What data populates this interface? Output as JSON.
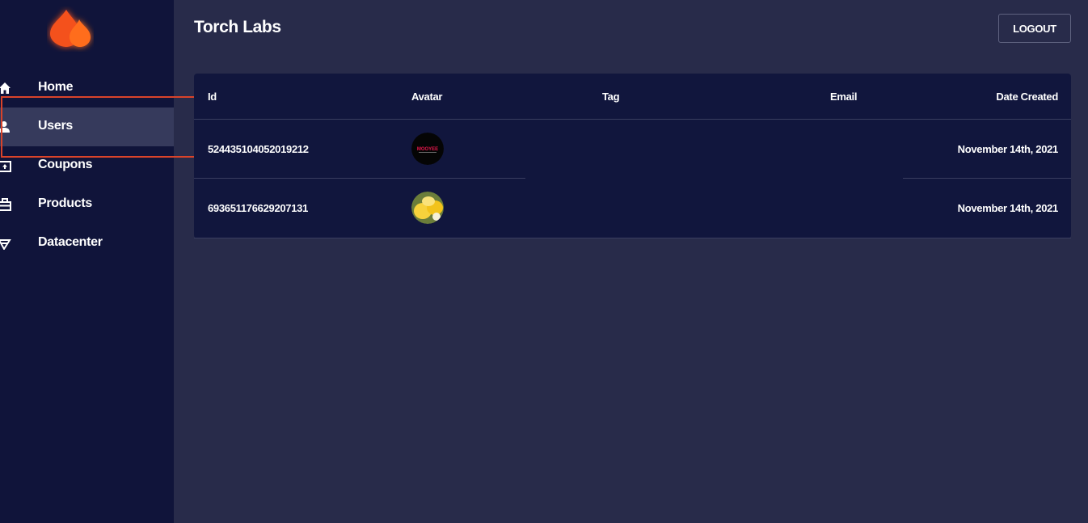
{
  "app": {
    "title_bold": "Torch",
    "title_rest": "Labs"
  },
  "header": {
    "logout_label": "LOGOUT"
  },
  "sidebar": {
    "items": [
      {
        "label": "Home",
        "icon": "home-icon",
        "active": false
      },
      {
        "label": "Users",
        "icon": "user-icon",
        "active": true
      },
      {
        "label": "Coupons",
        "icon": "coupon-icon",
        "active": false
      },
      {
        "label": "Products",
        "icon": "briefcase-icon",
        "active": false
      },
      {
        "label": "Datacenter",
        "icon": "datacenter-icon",
        "active": false
      }
    ]
  },
  "table": {
    "columns": [
      "Id",
      "Avatar",
      "Tag",
      "Email",
      "Date Created"
    ],
    "rows": [
      {
        "id": "524435104052019212",
        "avatar": "black-logo-avatar",
        "avatar_text": "MOOYEE",
        "tag": "",
        "email": "",
        "date": "November 14th, 2021"
      },
      {
        "id": "693651176629207131",
        "avatar": "lemon-avatar",
        "tag": "",
        "email": "",
        "date": "November 14th, 2021"
      }
    ]
  },
  "colors": {
    "sidebar_bg": "#10143a",
    "main_bg": "#282b4a",
    "table_bg": "#11163d",
    "active_item_bg": "#363a5c",
    "highlight_border": "#d9432a",
    "brand_flame": "#f4511e"
  }
}
